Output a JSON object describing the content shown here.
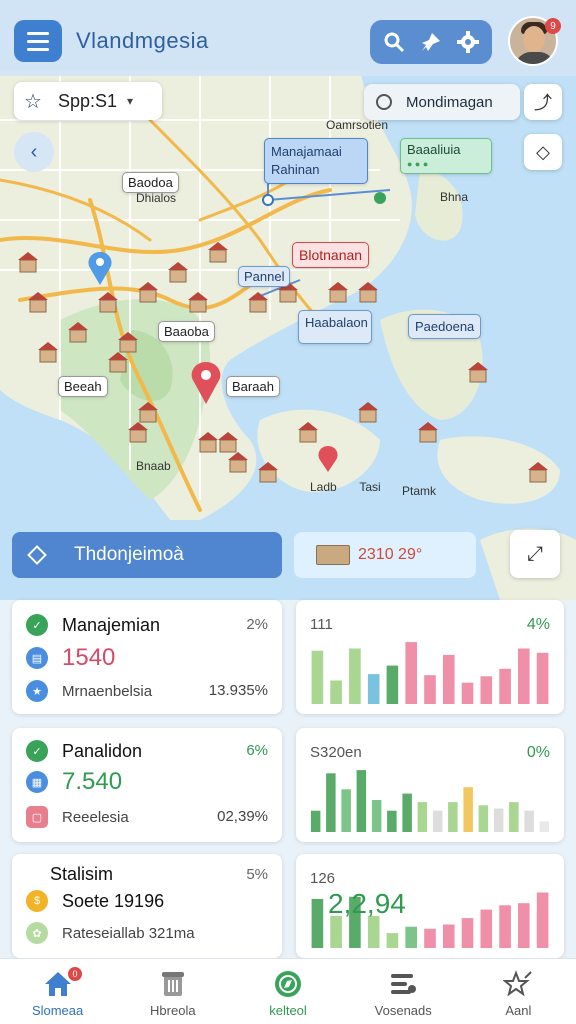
{
  "header": {
    "title": "Vlandmgesia",
    "actions": [
      "search-icon",
      "pin-icon",
      "gear-icon"
    ],
    "avatar_badge": "9"
  },
  "map": {
    "search_left": {
      "text": "Spp:S1",
      "icon": "star-icon"
    },
    "search_right": {
      "text": "Mondimagan",
      "icon": "search-icon"
    },
    "labels": {
      "top_city": "Oamrsotien",
      "tag_manajemen": "Manajamaai",
      "tag_manajemen_sub": "Rahinan",
      "tag_bastalusia": "Baaaliuia",
      "tag_bastalusia_sub": "● ● ●",
      "tag_bnaab": "Bnaab",
      "tag_dhialos": "Dhialos",
      "tag_pannel": "Pannel",
      "tag_bonanan": "Blotnanan",
      "tag_haabalaon": "Haabalaon",
      "tag_baoodoa": "Baodoa",
      "tag_paedoena": "Paedoena",
      "tag_baaoba": "Baaoba",
      "tag_beeah": "Beeah",
      "tag_baraah": "Baraah",
      "lbl_jsad": "Ladb",
      "lbl_tasi": " Tasi",
      "lbl_bhna": "Bhna",
      "lbl_pitsonk": "Ptamk"
    }
  },
  "banner": {
    "title": "Thdonjeimoà",
    "stat": "2310 29°"
  },
  "cards": [
    {
      "title": "Manajemian",
      "pct": "2%",
      "value": "1540",
      "value_color": "#d64a6a",
      "sub": "Mrnaenbelsia",
      "sub_pct": "13.935%",
      "icons": [
        "#3aa35a",
        "#4a8ee0",
        "#4a8ee0"
      ]
    },
    {
      "title": "Panalidon",
      "pct": "6%",
      "value": "7.540",
      "value_color": "#2f9a50",
      "sub": "Reeelesia",
      "sub_pct": "02,39%",
      "icons": [
        "#3aa35a",
        "#4a8ee0",
        "#e87f8f"
      ]
    },
    {
      "title": "Stalisim",
      "pct": "5%",
      "value": "Soete 19196",
      "value_color": "#111",
      "sub": "Rateseiallab 321ma",
      "sub_pct": "",
      "icons": [
        "#f2b327",
        "#b5dba0"
      ]
    }
  ],
  "chart_cards": [
    {
      "head_left": "111",
      "head_right": "4%",
      "head_right_color": "#2f9a50"
    },
    {
      "head_left": "S320en",
      "head_right": "0%",
      "head_right_color": "#2f9a50"
    },
    {
      "head_left": "126",
      "head_right": "",
      "head_right_color": "#2f9a50",
      "overlay": "2,2,94"
    }
  ],
  "chart_data": [
    {
      "type": "bar",
      "categories": [
        "1",
        "2",
        "3",
        "4",
        "5",
        "6",
        "7",
        "8",
        "9",
        "10",
        "11",
        "12",
        "13"
      ],
      "values": [
        50,
        22,
        52,
        28,
        36,
        58,
        27,
        46,
        20,
        26,
        33,
        52,
        48
      ],
      "colors": [
        "#a9d690",
        "#a9d690",
        "#a9d690",
        "#7ac3e0",
        "#5aaa6a",
        "#ef8fa8",
        "#ef8fa8",
        "#ef8fa8",
        "#ef8fa8",
        "#ef8fa8",
        "#ef8fa8",
        "#ef8fa8",
        "#ef8fa8"
      ]
    },
    {
      "type": "bar",
      "categories": [
        "1",
        "2",
        "3",
        "4",
        "5",
        "6",
        "7",
        "8",
        "9",
        "10",
        "11",
        "12",
        "13",
        "14",
        "15",
        "16"
      ],
      "values": [
        20,
        55,
        40,
        58,
        30,
        20,
        36,
        28,
        20,
        28,
        42,
        25,
        22,
        28,
        20,
        10
      ],
      "colors": [
        "#5aaa6a",
        "#5aaa6a",
        "#7cc488",
        "#5aaa6a",
        "#7cc488",
        "#5aaa6a",
        "#5aaa6a",
        "#a9d690",
        "#dddddd",
        "#a9d690",
        "#f2c760",
        "#a9d690",
        "#dddddd",
        "#a9d690",
        "#dddddd",
        "#e9e9e9"
      ]
    },
    {
      "type": "bar",
      "categories": [
        "1",
        "2",
        "3",
        "4",
        "5",
        "6",
        "7",
        "8",
        "9",
        "10",
        "11",
        "12",
        "13"
      ],
      "values": [
        46,
        30,
        48,
        30,
        14,
        20,
        18,
        22,
        28,
        36,
        40,
        42,
        52
      ],
      "colors": [
        "#5aaa6a",
        "#a9d690",
        "#5aaa6a",
        "#a9d690",
        "#a9d690",
        "#7cc488",
        "#ef8fa8",
        "#ef8fa8",
        "#ef8fa8",
        "#ef8fa8",
        "#ef8fa8",
        "#ef8fa8",
        "#ef8fa8"
      ]
    }
  ],
  "nav": [
    {
      "label": "Slomeaa",
      "icon": "home-icon",
      "badge": "0"
    },
    {
      "label": "Hbreola",
      "icon": "trash-icon"
    },
    {
      "label": "kelteol",
      "icon": "compass-icon"
    },
    {
      "label": "Vosenads",
      "icon": "list-icon"
    },
    {
      "label": "Aanl",
      "icon": "star-icon"
    }
  ],
  "colors": {
    "primary": "#4f86cf",
    "sea": "#bfe0f7",
    "land": "#eef1e4"
  }
}
